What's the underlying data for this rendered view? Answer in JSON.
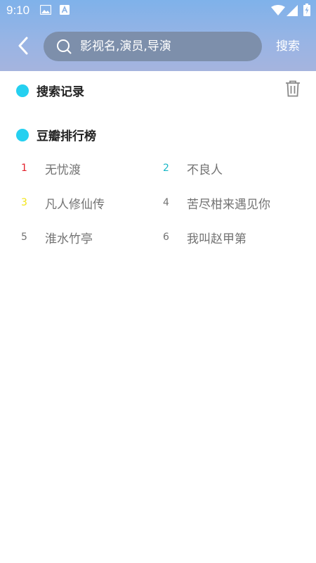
{
  "status_bar": {
    "time": "9:10",
    "icons": [
      "image-notification-icon",
      "font-notification-icon",
      "wifi-icon",
      "signal-icon",
      "battery-icon"
    ]
  },
  "header": {
    "back_icon": "chevron-left-icon",
    "search": {
      "icon": "search-icon",
      "placeholder": "影视名,演员,导演",
      "value": ""
    },
    "search_button": "搜索"
  },
  "search_history": {
    "title": "搜索记录",
    "clear_icon": "trash-icon"
  },
  "douban_ranking": {
    "title": "豆瓣排行榜",
    "items": [
      {
        "rank": "1",
        "title": "无忧渡",
        "rank_color": "#e3202b"
      },
      {
        "rank": "2",
        "title": "不良人",
        "rank_color": "#19b7c7"
      },
      {
        "rank": "3",
        "title": "凡人修仙传",
        "rank_color": "#f2e416"
      },
      {
        "rank": "4",
        "title": "苦尽柑来遇见你",
        "rank_color": "#737373"
      },
      {
        "rank": "5",
        "title": "淮水竹亭",
        "rank_color": "#737373"
      },
      {
        "rank": "6",
        "title": "我叫赵甲第",
        "rank_color": "#737373"
      }
    ]
  },
  "colors": {
    "accent_dot": "#25d0f0",
    "header_gradient_top": "#7fb2ea",
    "header_gradient_bottom": "#a5b4de",
    "search_box_bg": "#7d8fab"
  }
}
